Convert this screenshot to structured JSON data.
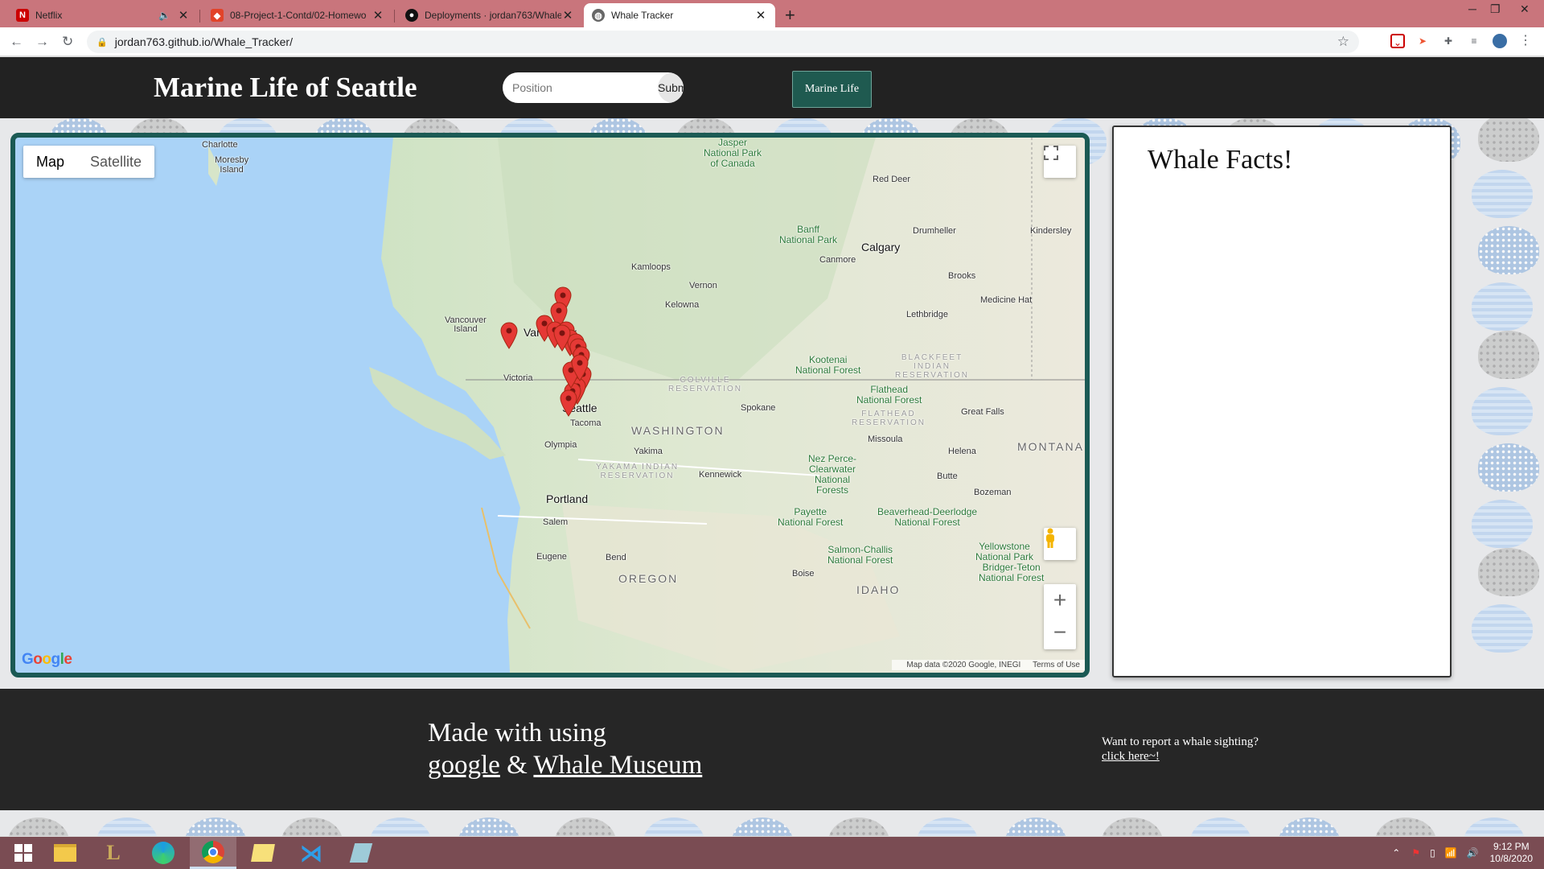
{
  "browser": {
    "tabs": [
      {
        "title": "Netflix",
        "favicon": "netflix-icon",
        "muted": true
      },
      {
        "title": "08-Project-1-Contd/02-Homewo",
        "favicon": "gitlab-icon"
      },
      {
        "title": "Deployments · jordan763/Whale_",
        "favicon": "github-icon"
      },
      {
        "title": "Whale Tracker",
        "favicon": "globe-icon",
        "active": true
      }
    ],
    "url": "jordan763.github.io/Whale_Tracker/"
  },
  "header": {
    "title": "Marine Life of Seattle",
    "search_placeholder": "Position",
    "submit_label": "Submit",
    "nav_button": "Marine Life"
  },
  "map": {
    "type_controls": {
      "map": "Map",
      "satellite": "Satellite"
    },
    "labels": {
      "charlotte": "Charlotte",
      "moresby": "Moresby\nIsland",
      "jasper": "Jasper\nNational Park\nof Canada",
      "red_deer": "Red Deer",
      "banff": "Banff\nNational Park",
      "drumheller": "Drumheller",
      "kindersley": "Kindersley",
      "calgary": "Calgary",
      "canmore": "Canmore",
      "kamloops": "Kamloops",
      "vernon": "Vernon",
      "brooks": "Brooks",
      "kelowna": "Kelowna",
      "medicine_hat": "Medicine Hat",
      "lethbridge": "Lethbridge",
      "vancouver_island": "Vancouver\nIsland",
      "vancouver": "Vancouver",
      "victoria": "Victoria",
      "blackfeet": "BLACKFEET\nINDIAN\nRESERVATION",
      "kootenai": "Kootenai\nNational Forest",
      "colville": "COLVILLE\nRESERVATION",
      "flathead_nf": "Flathead\nNational Forest",
      "spokane": "Spokane",
      "seattle": "Seattle",
      "flathead_res": "FLATHEAD\nRESERVATION",
      "great_falls": "Great Falls",
      "tacoma": "Tacoma",
      "washington": "WASHINGTON",
      "missoula": "Missoula",
      "montana": "MONTANA",
      "olympia": "Olympia",
      "yakima": "Yakima",
      "helena": "Helena",
      "nez_perce": "Nez Perce-\nClearwater\nNational\nForests",
      "yakama": "YAKAMA INDIAN\nRESERVATION",
      "kennewick": "Kennewick",
      "butte": "Butte",
      "bozeman": "Bozeman",
      "portland": "Portland",
      "payette": "Payette\nNational Forest",
      "beaverhead": "Beaverhead-Deerlodge\nNational Forest",
      "salem": "Salem",
      "yellowstone": "Yellowstone\nNational Park",
      "salmon": "Salmon-Challis\nNational Forest",
      "eugene": "Eugene",
      "bend": "Bend",
      "bridger": "Bridger-Teton\nNational Forest",
      "oregon": "OREGON",
      "boise": "Boise",
      "idaho": "IDAHO"
    },
    "google_logo": "Google",
    "attribution": {
      "data": "Map data ©2020 Google, INEGI",
      "terms": "Terms of Use"
    },
    "marker_color": "#e53935"
  },
  "facts": {
    "title": "Whale Facts!"
  },
  "footer": {
    "made_with": "Made with",
    "heart": "",
    "using": "using",
    "google_link": "google",
    "amp": "&",
    "museum_link": "Whale Museum",
    "report_question": "Want to report a whale sighting?",
    "report_link": "click here~!"
  },
  "taskbar": {
    "time": "9:12 PM",
    "date": "10/8/2020"
  },
  "colors": {
    "header_bg": "#222222",
    "accent": "#1f5a50",
    "tab_bar": "#c9757c"
  }
}
